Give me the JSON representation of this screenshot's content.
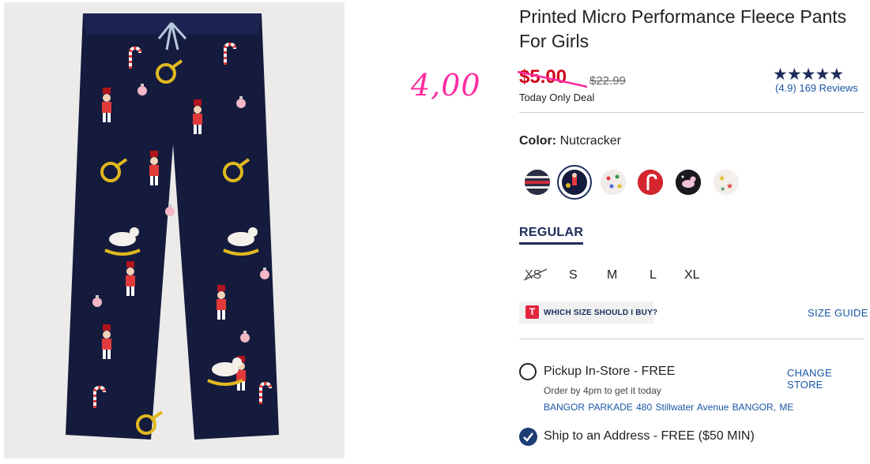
{
  "annotation": {
    "handwritten_price": "4,00"
  },
  "product": {
    "title": "Printed Micro Performance Fleece Pants For Girls",
    "sale_price": "$5.00",
    "original_price": "$22.99",
    "deal_label": "Today Only Deal",
    "rating": {
      "stars": 5,
      "summary": "(4.9) 169 Reviews"
    }
  },
  "color": {
    "label": "Color:",
    "selected": "Nutcracker",
    "swatches": [
      {
        "name": "fair-isle",
        "selected": false
      },
      {
        "name": "nutcracker",
        "selected": true
      },
      {
        "name": "dots",
        "selected": false
      },
      {
        "name": "candy-cane",
        "selected": false
      },
      {
        "name": "unicorn",
        "selected": false
      },
      {
        "name": "stars",
        "selected": false
      }
    ]
  },
  "size": {
    "tab": "REGULAR",
    "options": [
      {
        "label": "XS",
        "available": false
      },
      {
        "label": "S",
        "available": true
      },
      {
        "label": "M",
        "available": true
      },
      {
        "label": "L",
        "available": true
      },
      {
        "label": "XL",
        "available": true
      }
    ],
    "fit_icon": "T",
    "fit_help": "WHICH SIZE SHOULD I BUY?",
    "size_guide": "SIZE GUIDE"
  },
  "fulfillment": {
    "pickup_label": "Pickup In-Store - FREE",
    "pickup_selected": false,
    "change_store": "CHANGE STORE",
    "order_by": "Order by 4pm to get it today",
    "store_address": "BANGOR PARKADE 480 Stillwater Avenue  BANGOR, ME",
    "ship_label": "Ship to an Address - FREE ($50 MIN)",
    "ship_selected": true
  },
  "colors": {
    "navy": "#1c2c5b",
    "sale_red": "#d0021b",
    "link_blue": "#1a56a5",
    "annotation_pink": "#ff2aa0"
  }
}
